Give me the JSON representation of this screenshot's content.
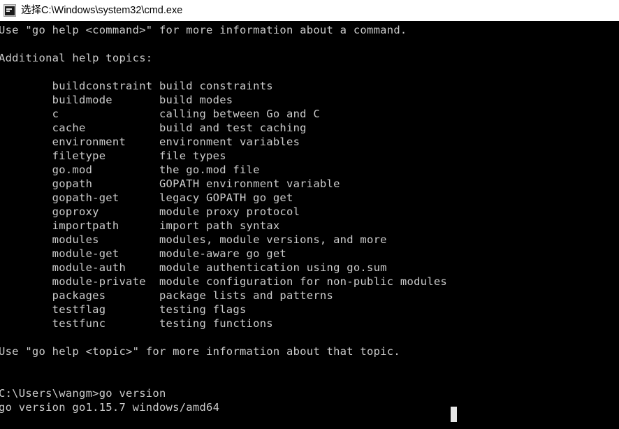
{
  "window": {
    "title": "选择C:\\Windows\\system32\\cmd.exe",
    "icon": "console-window-icon",
    "titlebar_bg": "#ffffff",
    "titlebar_fg": "#000000"
  },
  "terminal": {
    "background": "#000000",
    "foreground": "#cccccc",
    "cursor_color": "#e6e6e6",
    "cursor_style": "block",
    "header_lines": [
      "Use \"go help <command>\" for more information about a command.",
      "",
      "Additional help topics:",
      ""
    ],
    "topics_heading": "Additional help topics:",
    "help_command_line": "Use \"go help <command>\" for more information about a command.",
    "help_topic_line": "Use \"go help <topic>\" for more information about that topic.",
    "topics": [
      {
        "name": "buildconstraint",
        "description": "build constraints"
      },
      {
        "name": "buildmode",
        "description": "build modes"
      },
      {
        "name": "c",
        "description": "calling between Go and C"
      },
      {
        "name": "cache",
        "description": "build and test caching"
      },
      {
        "name": "environment",
        "description": "environment variables"
      },
      {
        "name": "filetype",
        "description": "file types"
      },
      {
        "name": "go.mod",
        "description": "the go.mod file"
      },
      {
        "name": "gopath",
        "description": "GOPATH environment variable"
      },
      {
        "name": "gopath-get",
        "description": "legacy GOPATH go get"
      },
      {
        "name": "goproxy",
        "description": "module proxy protocol"
      },
      {
        "name": "importpath",
        "description": "import path syntax"
      },
      {
        "name": "modules",
        "description": "modules, module versions, and more"
      },
      {
        "name": "module-get",
        "description": "module-aware go get"
      },
      {
        "name": "module-auth",
        "description": "module authentication using go.sum"
      },
      {
        "name": "module-private",
        "description": "module configuration for non-public modules"
      },
      {
        "name": "packages",
        "description": "package lists and patterns"
      },
      {
        "name": "testflag",
        "description": "testing flags"
      },
      {
        "name": "testfunc",
        "description": "testing functions"
      }
    ],
    "prompt": "C:\\Users\\wangm>",
    "command": "go version",
    "command_output": "go version go1.15.7 windows/amd64",
    "full_text": "Use \"go help <command>\" for more information about a command.\n\nAdditional help topics:\n\n        buildconstraint build constraints\n        buildmode       build modes\n        c               calling between Go and C\n        cache           build and test caching\n        environment     environment variables\n        filetype        file types\n        go.mod          the go.mod file\n        gopath          GOPATH environment variable\n        gopath-get      legacy GOPATH go get\n        goproxy         module proxy protocol\n        importpath      import path syntax\n        modules         modules, module versions, and more\n        module-get      module-aware go get\n        module-auth     module authentication using go.sum\n        module-private  module configuration for non-public modules\n        packages        package lists and patterns\n        testflag        testing flags\n        testfunc        testing functions\n\nUse \"go help <topic>\" for more information about that topic.\n\n\nC:\\Users\\wangm>go version\ngo version go1.15.7 windows/amd64"
  }
}
